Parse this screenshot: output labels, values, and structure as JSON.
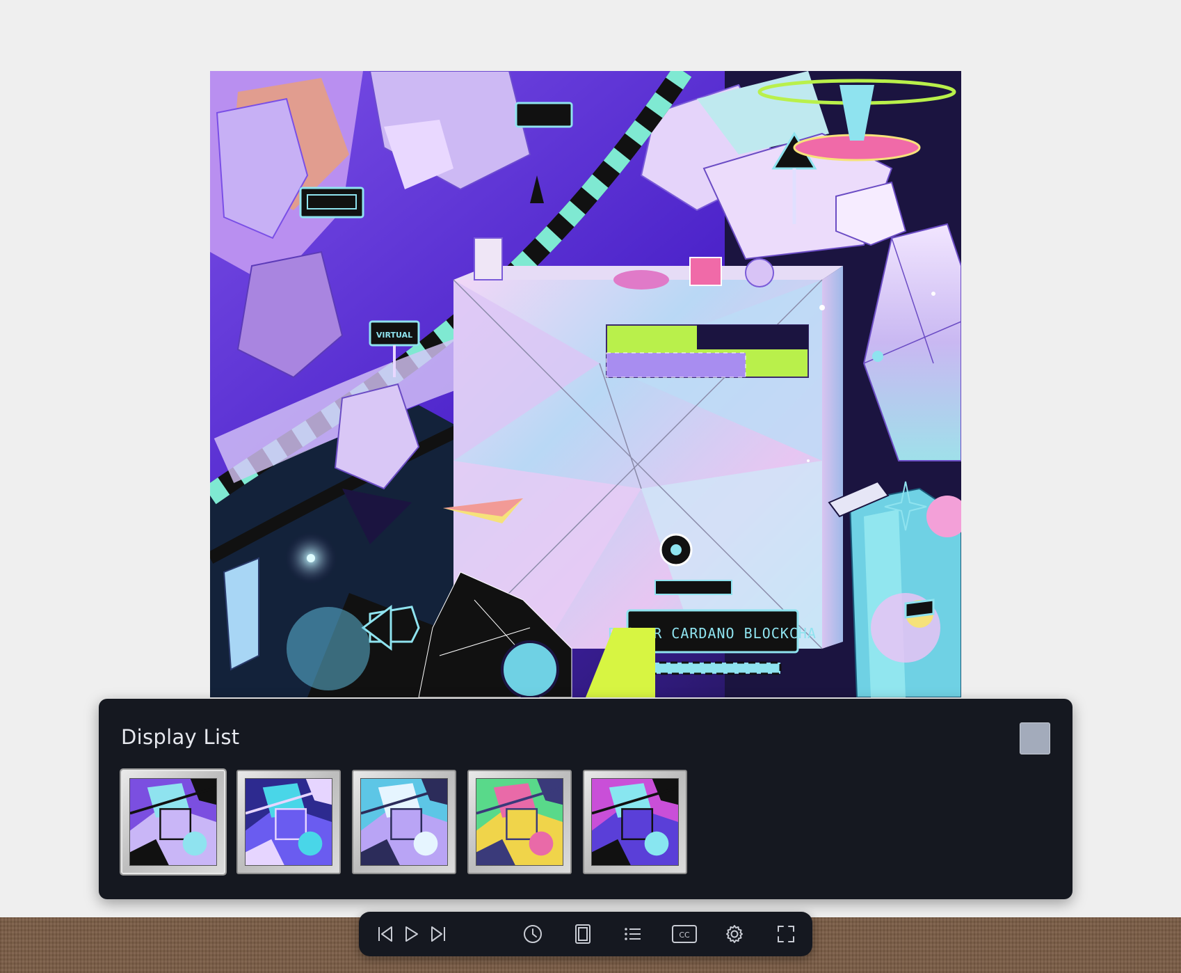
{
  "artwork": {
    "sign_virtual": "VIRTUAL",
    "banner_text": "PLORER CARDANO BLOCKCHA",
    "colors": {
      "sky_purple": "#5a2fd0",
      "night": "#1b1440",
      "crystal_pink": "#e9c9f3",
      "crystal_cyan": "#8fe3ef",
      "lime": "#d7f542",
      "black": "#111111"
    }
  },
  "display_list": {
    "title": "Display List",
    "close_icon": "square-close-icon",
    "selected_index": 0,
    "thumbnails": [
      {
        "palette": [
          "#7b4fe0",
          "#c9b6f7",
          "#111111",
          "#8fe3ef"
        ]
      },
      {
        "palette": [
          "#2d2a8f",
          "#6a5cf0",
          "#e6d5ff",
          "#49d6e8"
        ]
      },
      {
        "palette": [
          "#5dc6e6",
          "#b9a4f5",
          "#2c2c5a",
          "#e6f5ff"
        ]
      },
      {
        "palette": [
          "#59d98a",
          "#f0d44a",
          "#3a3a7a",
          "#e96aa8"
        ]
      },
      {
        "palette": [
          "#c94fd8",
          "#5a3fd8",
          "#111111",
          "#88e6f0"
        ]
      }
    ]
  },
  "controls": {
    "buttons": [
      {
        "name": "previous-button",
        "icon": "skip-back-icon"
      },
      {
        "name": "play-button",
        "icon": "play-icon"
      },
      {
        "name": "next-button",
        "icon": "skip-forward-icon"
      },
      {
        "name": "timer-button",
        "icon": "clock-icon"
      },
      {
        "name": "frame-button",
        "icon": "frame-icon"
      },
      {
        "name": "display-list-button",
        "icon": "list-icon"
      },
      {
        "name": "captions-button",
        "icon": "cc-icon",
        "label": "CC"
      },
      {
        "name": "settings-button",
        "icon": "gear-icon"
      },
      {
        "name": "fullscreen-button",
        "icon": "fullscreen-icon"
      }
    ]
  }
}
